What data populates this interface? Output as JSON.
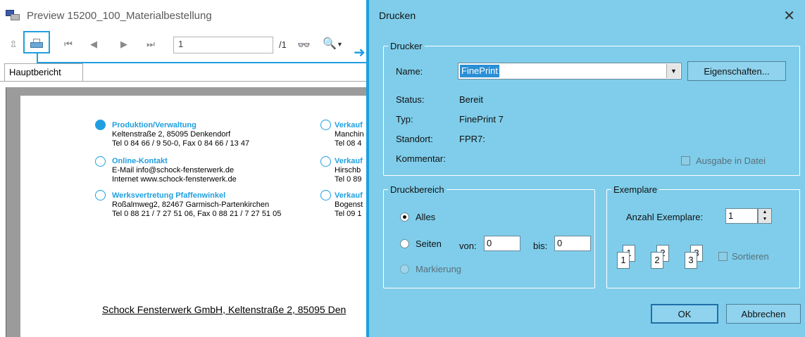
{
  "preview": {
    "title": "Preview 15200_100_Materialbestellung",
    "page_input": "1",
    "page_total": "/1",
    "tab": "Hauptbericht"
  },
  "report": {
    "blocks": [
      {
        "heading": "Produktion/Verwaltung",
        "lines": [
          "Keltenstraße 2, 85095 Denkendorf",
          "Tel 0 84 66 / 9 50-0, Fax 0 84 66 / 13 47"
        ]
      },
      {
        "heading": "Online-Kontakt",
        "lines": [
          "E-Mail info@schock-fensterwerk.de",
          "Internet www.schock-fensterwerk.de"
        ]
      },
      {
        "heading": "Werksvertretung Pfaffenwinkel",
        "lines": [
          "Roßalmweg2, 82467 Garmisch-Partenkirchen",
          "Tel 0 88 21 / 7 27 51 06, Fax 0 88 21 / 7 27 51 05"
        ]
      }
    ],
    "right_blocks": [
      {
        "heading": "Verkauf",
        "lines": [
          "Manchin",
          "Tel 08 4"
        ]
      },
      {
        "heading": "Verkauf",
        "lines": [
          "Hirschb",
          "Tel 0 89"
        ]
      },
      {
        "heading": "Verkauf",
        "lines": [
          "Bogenst",
          "Tel 09 1"
        ]
      }
    ],
    "footer": "Schock Fensterwerk GmbH, Keltenstraße 2, 85095 Den"
  },
  "dialog": {
    "title": "Drucken",
    "printer_group": "Drucker",
    "name_label": "Name:",
    "name_value": "FinePrint",
    "properties_button": "Eigenschaften...",
    "status_label": "Status:",
    "status_value": "Bereit",
    "type_label": "Typ:",
    "type_value": "FinePrint 7",
    "location_label": "Standort:",
    "location_value": "FPR7:",
    "comment_label": "Kommentar:",
    "print_to_file": "Ausgabe in Datei",
    "range_group": "Druckbereich",
    "range_all": "Alles",
    "range_pages": "Seiten",
    "from_label": "von:",
    "from_value": "0",
    "to_label": "bis:",
    "to_value": "0",
    "range_selection": "Markierung",
    "copies_group": "Exemplare",
    "copies_label": "Anzahl Exemplare:",
    "copies_value": "1",
    "collate": "Sortieren",
    "collate_pages": [
      "1",
      "1",
      "2",
      "2",
      "3",
      "3"
    ],
    "ok": "OK",
    "cancel": "Abbrechen"
  },
  "colors": {
    "accent": "#1f9fe0",
    "dialog_bg": "#7fcdea",
    "selection": "#2a8fd6"
  }
}
